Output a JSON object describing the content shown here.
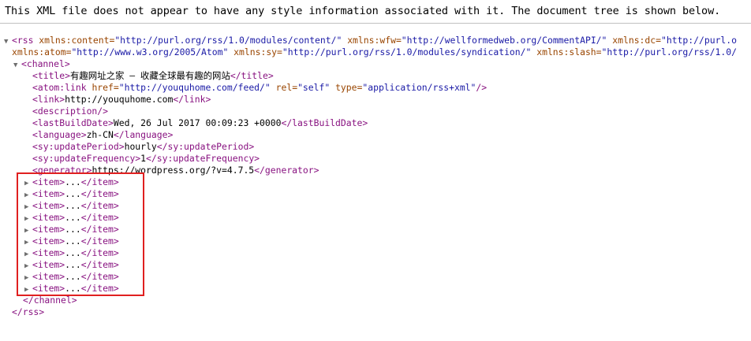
{
  "header": {
    "message": "This XML file does not appear to have any style information associated with it. The document tree is shown below."
  },
  "rss": {
    "open_tag": "<rss",
    "attrs_line1": [
      {
        "name": "xmlns:content",
        "value": "\"http://purl.org/rss/1.0/modules/content/\""
      },
      {
        "name": "xmlns:wfw",
        "value": "\"http://wellformedweb.org/CommentAPI/\""
      },
      {
        "name": "xmlns:dc",
        "value": "\"http://purl.o"
      }
    ],
    "attrs_line2": [
      {
        "name": "xmlns:atom",
        "value": "\"http://www.w3.org/2005/Atom\""
      },
      {
        "name": "xmlns:sy",
        "value": "\"http://purl.org/rss/1.0/modules/syndication/\""
      },
      {
        "name": "xmlns:slash",
        "value": "\"http://purl.org/rss/1.0/"
      }
    ],
    "close": "</rss>"
  },
  "channel": {
    "open": "<channel>",
    "close": "</channel>",
    "title_open": "<title>",
    "title_text": "有趣网址之家 – 收藏全球最有趣的网站",
    "title_close": "</title>",
    "atom_link_open": "<atom:link",
    "atom_href_name": "href=",
    "atom_href_val": "\"http://youquhome.com/feed/\"",
    "atom_rel_name": "rel=",
    "atom_rel_val": "\"self\"",
    "atom_type_name": "type=",
    "atom_type_val": "\"application/rss+xml\"",
    "atom_close": "/>",
    "link_open": "<link>",
    "link_text": "http://youquhome.com",
    "link_close": "</link>",
    "description": "<description/>",
    "lbd_open": "<lastBuildDate>",
    "lbd_text": "Wed, 26 Jul 2017 00:09:23 +0000",
    "lbd_close": "</lastBuildDate>",
    "lang_open": "<language>",
    "lang_text": "zh-CN",
    "lang_close": "</language>",
    "sup_open": "<sy:updatePeriod>",
    "sup_text": "hourly",
    "sup_close": "</sy:updatePeriod>",
    "suf_open": "<sy:updateFrequency>",
    "suf_text": "1",
    "suf_close": "</sy:updateFrequency>",
    "gen_open": "<generator>",
    "gen_text": "https://wordpress.org/?v=4.7.5",
    "gen_close": "</generator>"
  },
  "items": [
    {
      "open": "<item>",
      "ellipsis": "...",
      "close": "</item>"
    },
    {
      "open": "<item>",
      "ellipsis": "...",
      "close": "</item>"
    },
    {
      "open": "<item>",
      "ellipsis": "...",
      "close": "</item>"
    },
    {
      "open": "<item>",
      "ellipsis": "...",
      "close": "</item>"
    },
    {
      "open": "<item>",
      "ellipsis": "...",
      "close": "</item>"
    },
    {
      "open": "<item>",
      "ellipsis": "...",
      "close": "</item>"
    },
    {
      "open": "<item>",
      "ellipsis": "...",
      "close": "</item>"
    },
    {
      "open": "<item>",
      "ellipsis": "...",
      "close": "</item>"
    },
    {
      "open": "<item>",
      "ellipsis": "...",
      "close": "</item>"
    },
    {
      "open": "<item>",
      "ellipsis": "...",
      "close": "</item>"
    }
  ],
  "colors": {
    "tag": "#881280",
    "attr": "#994500",
    "value": "#1a1aa6",
    "highlight": "#e02020"
  }
}
